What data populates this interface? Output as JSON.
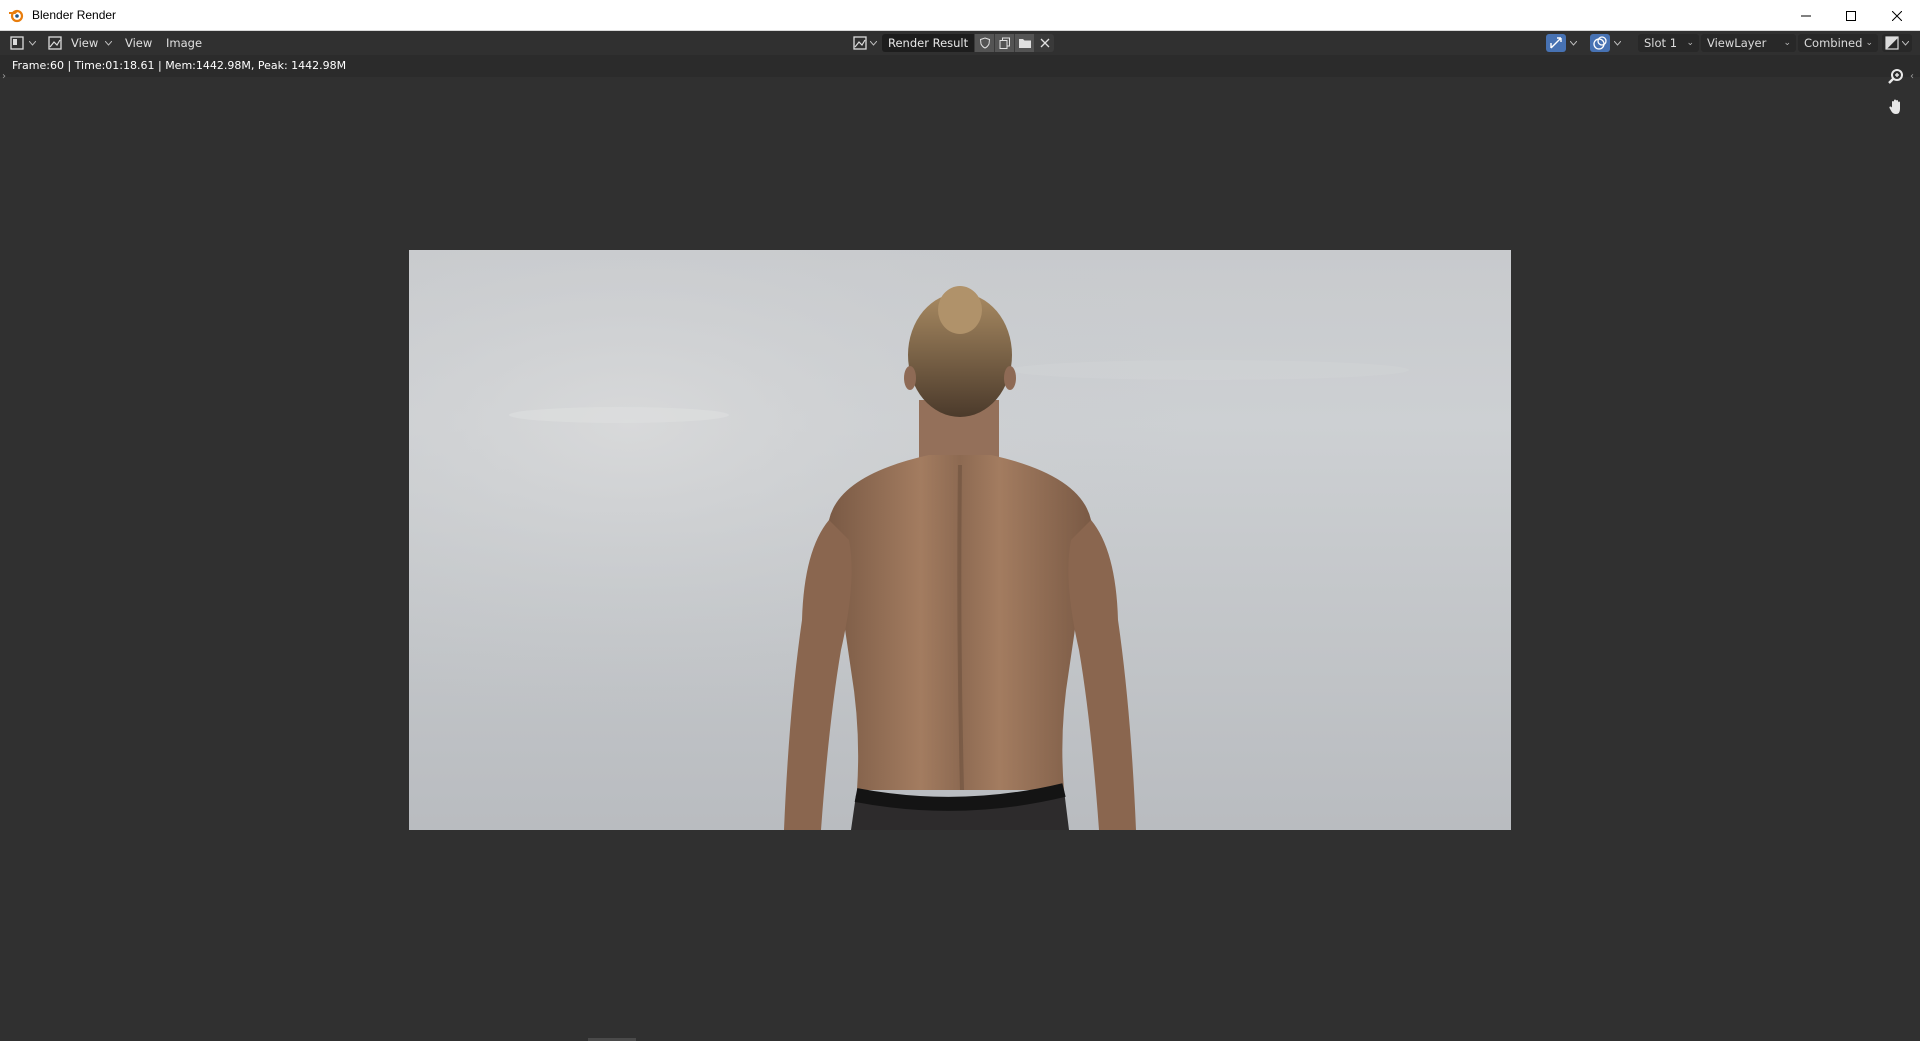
{
  "window": {
    "title": "Blender Render"
  },
  "header": {
    "menus": [
      "View",
      "Image"
    ],
    "view_label": "View",
    "image_name": "Render Result",
    "slot": "Slot 1",
    "view_layer": "ViewLayer",
    "pass": "Combined"
  },
  "info": {
    "text": "Frame:60 | Time:01:18.61 | Mem:1442.98M, Peak: 1442.98M"
  },
  "icons": {
    "editor_type": "image-editor-icon",
    "mode": "view-mode-icon",
    "image_browse": "image-browse-icon",
    "fake_user": "shield-icon",
    "new_image": "duplicate-icon",
    "open_image": "folder-icon",
    "unlink": "close-icon",
    "gizmo_toggle": "gizmo-icon",
    "overlay_toggle": "overlay-icon",
    "display_channels": "display-channels-icon",
    "zoom": "zoom-icon",
    "pan": "hand-icon"
  },
  "colors": {
    "accent": "#4772b3",
    "background": "#303030",
    "header_bg": "#303030"
  }
}
